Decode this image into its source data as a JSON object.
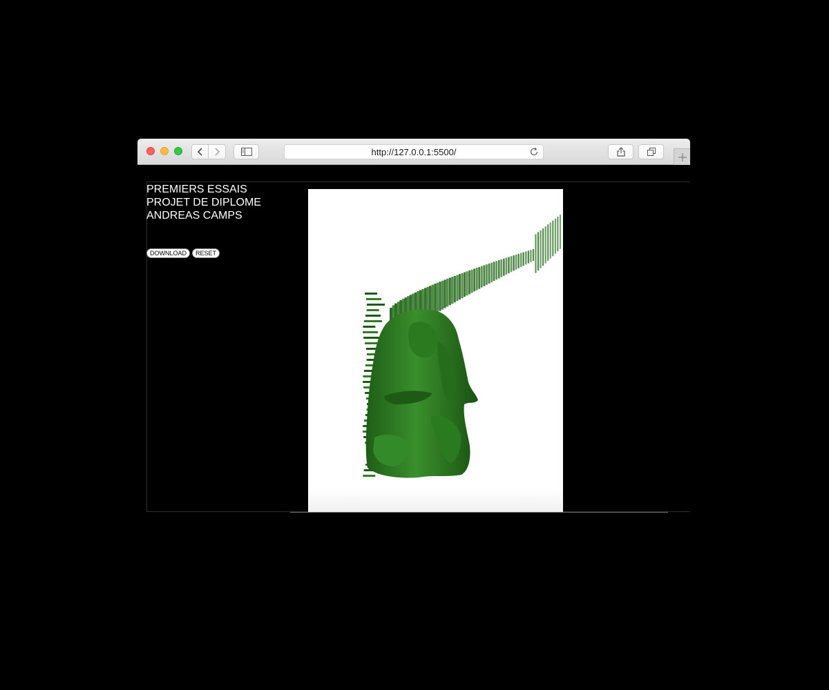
{
  "browser": {
    "url": "http://127.0.0.1:5500/"
  },
  "page": {
    "title_lines": [
      "PREMIERS ESSAIS",
      "PROJET DE DIPLOME",
      "ANDREAS CAMPS"
    ],
    "buttons": {
      "download_label": "DOWNLOAD",
      "reset_label": "RESET"
    }
  },
  "canvas": {
    "background": "#ffffff",
    "figure_color": "#2e7d22",
    "figure_shade": "#1c5a14",
    "figure_highlight": "#4a9a38"
  }
}
